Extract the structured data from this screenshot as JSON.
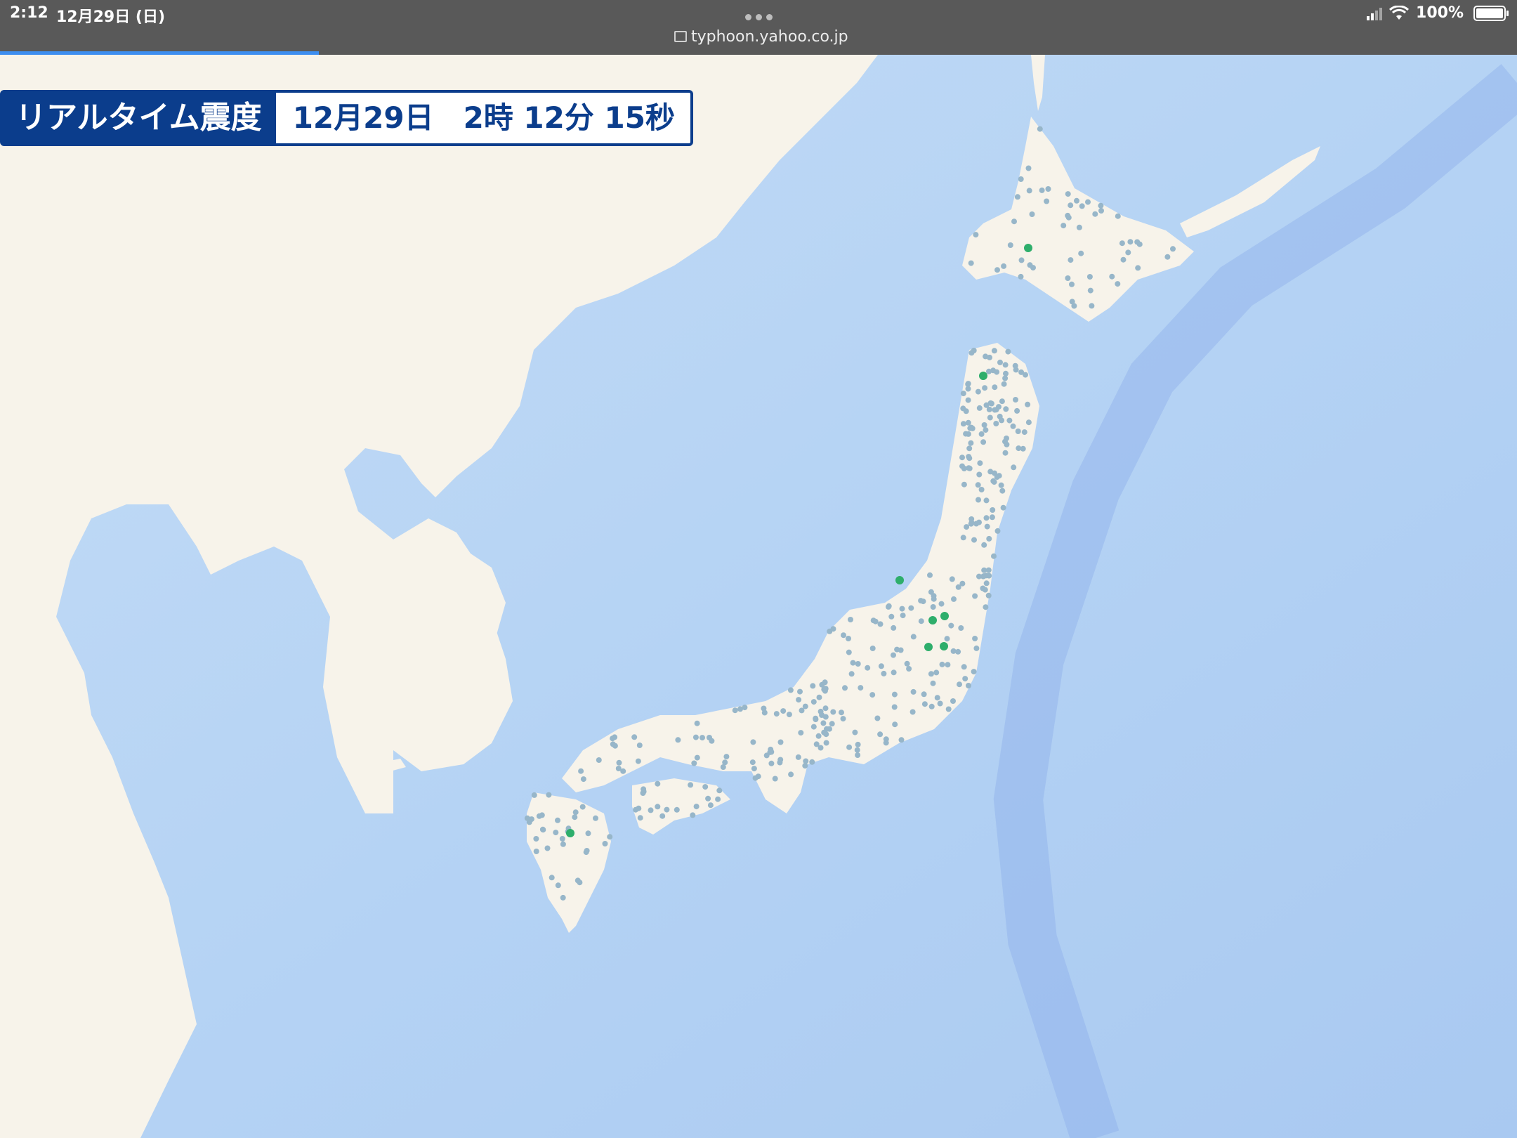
{
  "status_bar": {
    "time": "2:12",
    "date": "12月29日 (日)",
    "url": "typhoon.yahoo.co.jp",
    "battery": "100%"
  },
  "page_load_progress": 0.21,
  "banner": {
    "label": "リアルタイム震度",
    "timestamp": "12月29日　2時 12分 15秒"
  },
  "map": {
    "land_color": "#f7f3ea",
    "sea_color": "#bcd9f7",
    "station_color_low": "#97b6c9",
    "station_color_felt": "#2eae6b"
  }
}
